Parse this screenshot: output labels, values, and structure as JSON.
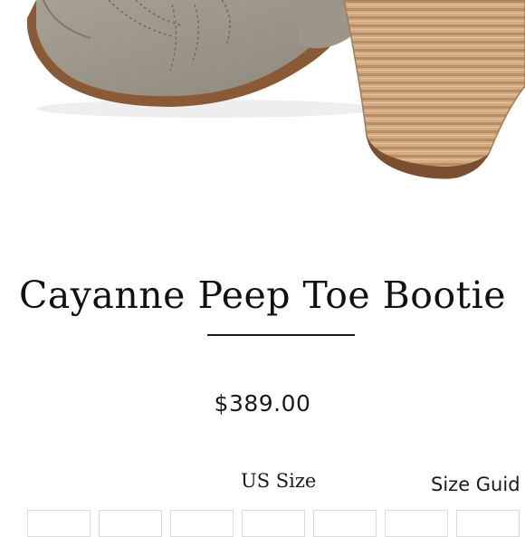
{
  "product": {
    "image_icon": "bootie-product-photo",
    "title": "Cayanne Peep Toe Bootie",
    "price": "$389.00"
  },
  "size_selector": {
    "label": "US Size",
    "guide_link": "Size Guid",
    "options_visible_count": 7
  },
  "colors": {
    "suede": "#a09a8f",
    "heel_wood": "#cba27a",
    "text": "#111111"
  }
}
